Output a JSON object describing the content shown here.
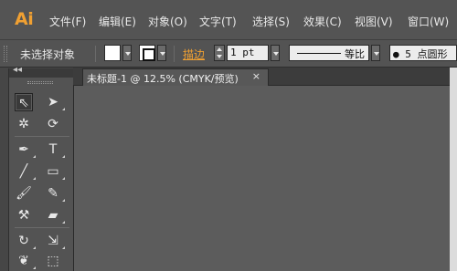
{
  "app": {
    "logo": "Ai",
    "brand_color": "#f0a032"
  },
  "menu": [
    {
      "label": "文件(F)"
    },
    {
      "label": "编辑(E)"
    },
    {
      "label": "对象(O)"
    },
    {
      "label": "文字(T)"
    },
    {
      "label": "选择(S)"
    },
    {
      "label": "效果(C)"
    },
    {
      "label": "视图(V)"
    },
    {
      "label": "窗口(W)"
    }
  ],
  "control_bar": {
    "selection_status": "未选择对象",
    "fill_color": "#ffffff",
    "stroke_link": "描边",
    "stroke_weight": "1 pt",
    "line_profile": "等比",
    "brush": "● 5 点圆形"
  },
  "document": {
    "tab_title": "未标题-1 @ 12.5% (CMYK/预览)",
    "close_glyph": "×"
  },
  "toolbox": {
    "collapse_glyph": "◂◂",
    "tools": [
      {
        "glyph": "⇖"
      },
      {
        "glyph": "➤"
      },
      {
        "glyph": "✲"
      },
      {
        "glyph": "⟳"
      },
      {
        "glyph": "✒"
      },
      {
        "glyph": "T"
      },
      {
        "glyph": "╱"
      },
      {
        "glyph": "▭"
      },
      {
        "glyph": "🖌"
      },
      {
        "glyph": "✎"
      },
      {
        "glyph": "⚒"
      },
      {
        "glyph": "▰"
      },
      {
        "glyph": "↻"
      },
      {
        "glyph": "⇲"
      },
      {
        "glyph": "❦"
      },
      {
        "glyph": "⬚"
      }
    ]
  }
}
